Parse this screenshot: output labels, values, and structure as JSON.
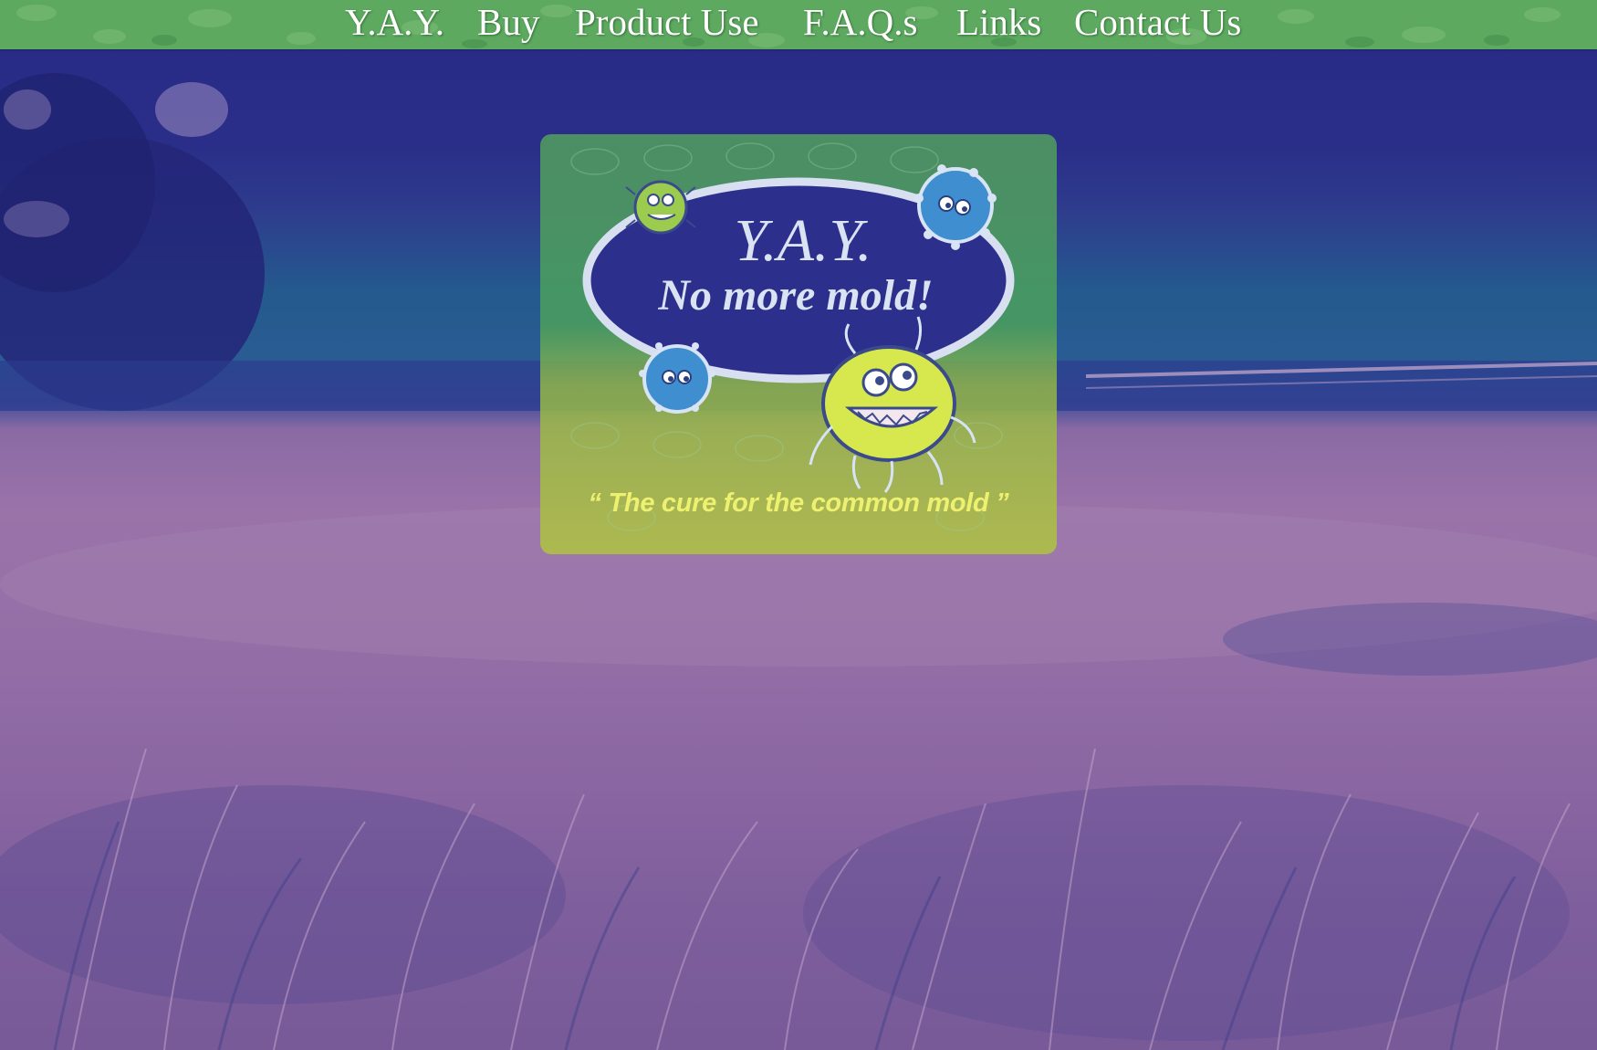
{
  "nav": {
    "items": [
      {
        "label": "Y.A.Y."
      },
      {
        "label": "Buy"
      },
      {
        "label": "Product Use"
      },
      {
        "label": "F.A.Q.s"
      },
      {
        "label": "Links"
      },
      {
        "label": "Contact Us"
      }
    ]
  },
  "logo": {
    "title": "Y.A.Y.",
    "subtitle": "No more mold!",
    "tagline": "“ The cure for the common mold ”"
  },
  "colors": {
    "nav_bar": "#5da960",
    "sky": "#272b85",
    "field": "#946fa7",
    "logo_card": "#78b25a",
    "tagline": "#eef070"
  },
  "icons": [
    "mold-germ-icon",
    "leaf-pattern"
  ]
}
